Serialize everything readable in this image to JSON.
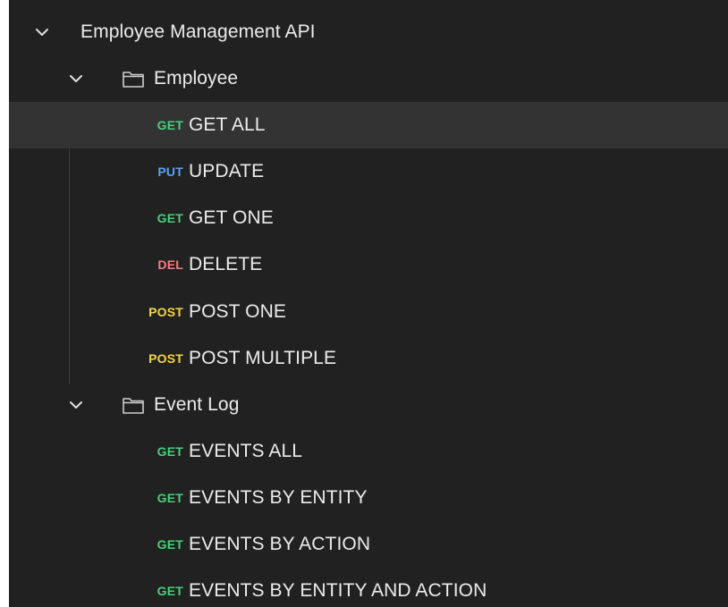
{
  "collection": {
    "name": "Employee Management API"
  },
  "folders": [
    {
      "name": "Employee",
      "requests": [
        {
          "method": "GET",
          "name": "GET ALL"
        },
        {
          "method": "PUT",
          "name": "UPDATE"
        },
        {
          "method": "GET",
          "name": "GET ONE"
        },
        {
          "method": "DEL",
          "name": "DELETE"
        },
        {
          "method": "POST",
          "name": "POST ONE"
        },
        {
          "method": "POST",
          "name": "POST MULTIPLE"
        }
      ]
    },
    {
      "name": "Event Log",
      "requests": [
        {
          "method": "GET",
          "name": "EVENTS ALL"
        },
        {
          "method": "GET",
          "name": "EVENTS BY ENTITY"
        },
        {
          "method": "GET",
          "name": "EVENTS BY ACTION"
        },
        {
          "method": "GET",
          "name": "EVENTS BY ENTITY AND ACTION"
        }
      ]
    }
  ],
  "icons": {
    "chevron": "chevron-down-icon",
    "folder": "folder-icon"
  },
  "colors": {
    "panel_background": "#212121",
    "selected_row": "#333333",
    "text": "#ececec",
    "get": "#49d07a",
    "put": "#5aa1f2",
    "del": "#f07f85",
    "post": "#f5d547"
  }
}
